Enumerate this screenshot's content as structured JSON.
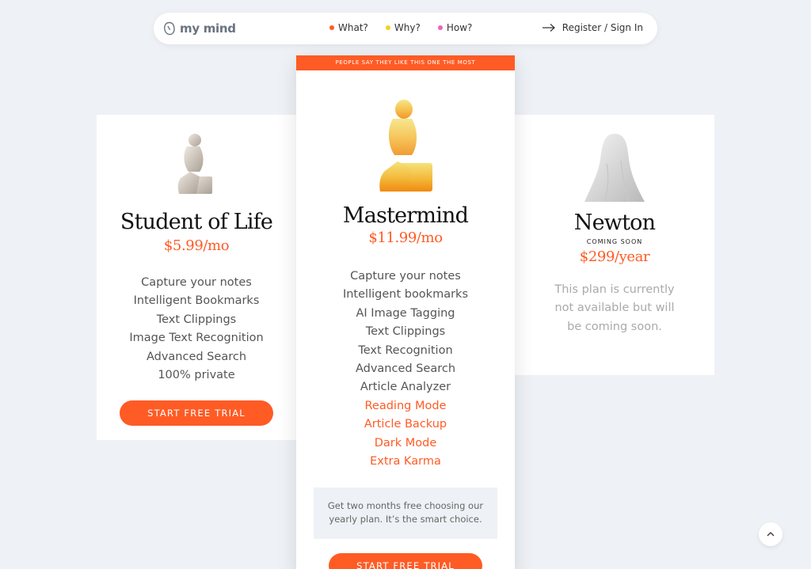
{
  "nav": {
    "logo_text": "my mind",
    "links": [
      {
        "label": "What?",
        "dot_color": "#ff5b25"
      },
      {
        "label": "Why?",
        "dot_color": "#f3d21a"
      },
      {
        "label": "How?",
        "dot_color": "#f05fc0"
      }
    ],
    "signin_label": "Register / Sign In"
  },
  "plans": {
    "student": {
      "name": "Student of Life",
      "price": "$5.99/mo",
      "features": [
        "Capture your notes",
        "Intelligent Bookmarks",
        "Text Clippings",
        "Image Text Recognition",
        "Advanced Search",
        "100% private"
      ],
      "cta": "START FREE TRIAL"
    },
    "mastermind": {
      "banner": "PEOPLE SAY THEY LIKE THIS ONE THE MOST",
      "name": "Mastermind",
      "price": "$11.99/mo",
      "features": [
        "Capture your notes",
        "Intelligent bookmarks",
        "AI Image Tagging",
        "Text Clippings",
        "Text Recognition",
        "Advanced Search",
        "Article Analyzer"
      ],
      "highlight_features": [
        "Reading Mode",
        "Article Backup",
        "Dark Mode",
        "Extra Karma"
      ],
      "note": "Get two months free choosing our yearly plan. It’s the smart choice.",
      "cta": "START FREE TRIAL"
    },
    "newton": {
      "name": "Newton",
      "status": "COMING SOON",
      "price": "$299/year",
      "description": "This plan is currently not available but will be coming soon."
    }
  },
  "colors": {
    "accent": "#ff5b25",
    "background": "#eef1f5"
  },
  "icons": {
    "scroll_top": "chevron-up-icon",
    "signin": "arrow-right-icon",
    "logo": "brain-icon"
  }
}
